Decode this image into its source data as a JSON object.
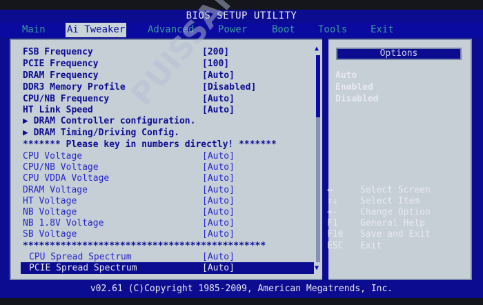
{
  "title": "BIOS SETUP UTILITY",
  "menu": [
    {
      "label": "Main",
      "active": false
    },
    {
      "label": "Ai Tweaker",
      "active": true
    },
    {
      "label": "Advanced",
      "active": false
    },
    {
      "label": "Power",
      "active": false
    },
    {
      "label": "Boot",
      "active": false
    },
    {
      "label": "Tools",
      "active": false
    },
    {
      "label": "Exit",
      "active": false
    }
  ],
  "settings": [
    {
      "label": "FSB Frequency",
      "value": "[200]"
    },
    {
      "label": "PCIE Frequency",
      "value": "[100]"
    },
    {
      "label": "DRAM Frequency",
      "value": "[Auto]"
    },
    {
      "label": "DDR3 Memory Profile",
      "value": "[Disabled]"
    },
    {
      "label": "CPU/NB Frequency",
      "value": "[Auto]"
    },
    {
      "label": "HT Link Speed",
      "value": "[Auto]"
    }
  ],
  "submenus": [
    "▶ DRAM Controller configuration.",
    "▶ DRAM Timing/Driving Config."
  ],
  "numbers_note": "******* Please key in numbers directly! *******",
  "voltages": [
    {
      "label": "CPU Voltage",
      "value": "[Auto]"
    },
    {
      "label": "CPU/NB Voltage",
      "value": "[Auto]"
    },
    {
      "label": "CPU VDDA Voltage",
      "value": "[Auto]"
    },
    {
      "label": "DRAM Voltage",
      "value": "[Auto]"
    },
    {
      "label": "HT Voltage",
      "value": "[Auto]"
    },
    {
      "label": "NB Voltage",
      "value": "[Auto]"
    },
    {
      "label": "NB 1.8V Voltage",
      "value": "[Auto]"
    },
    {
      "label": "SB Voltage",
      "value": "[Auto]"
    }
  ],
  "separator": "*********************************************",
  "spread": [
    {
      "label": "CPU Spread Spectrum",
      "value": "[Auto]",
      "selected": false
    },
    {
      "label": "PCIE Spread Spectrum",
      "value": "[Auto]",
      "selected": true
    }
  ],
  "options": {
    "title": "Options",
    "items": [
      "Auto",
      "Enabled",
      "Disabled"
    ]
  },
  "hotkeys": [
    {
      "key": "↔",
      "action": "Select Screen"
    },
    {
      "key": "↑↓",
      "action": "Select Item"
    },
    {
      "key": "+-",
      "action": "Change Option"
    },
    {
      "key": "F1",
      "action": "General Help"
    },
    {
      "key": "F10",
      "action": "Save and Exit"
    },
    {
      "key": "ESC",
      "action": "Exit"
    }
  ],
  "footer": "v02.61 (C)Copyright 1985-2009, American Megatrends, Inc.",
  "watermark": "PUISSANCE-PC",
  "colors": {
    "background": "#0c0c90",
    "panel": "#c6cfd6",
    "active_tab": "#c8d4d8"
  }
}
